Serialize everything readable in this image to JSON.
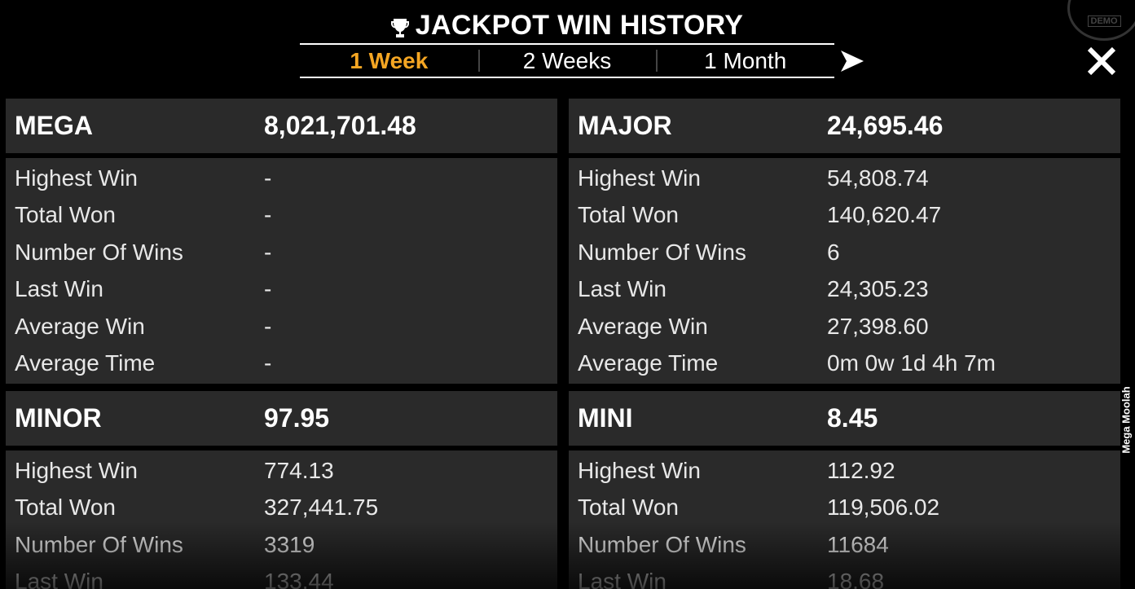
{
  "header": {
    "title": "JACKPOT WIN HISTORY",
    "tabs": [
      {
        "label": "1 Week",
        "active": true
      },
      {
        "label": "2 Weeks",
        "active": false
      },
      {
        "label": "1 Month",
        "active": false
      }
    ],
    "next_icon": "right-arrow-icon",
    "close_icon": "close-icon",
    "badge_text": "DEMO"
  },
  "side_label": "Mega Moolah",
  "colors": {
    "accent": "#f5a623",
    "panel_bg": "#2a2a2a",
    "background": "#000000"
  },
  "panels": [
    {
      "name": "MEGA",
      "amount": "8,021,701.48",
      "rows": [
        {
          "label": "Highest Win",
          "value": "-"
        },
        {
          "label": "Total Won",
          "value": "-"
        },
        {
          "label": "Number Of Wins",
          "value": "-"
        },
        {
          "label": "Last Win",
          "value": "-"
        },
        {
          "label": "Average Win",
          "value": "-"
        },
        {
          "label": "Average Time",
          "value": "-"
        }
      ]
    },
    {
      "name": "MAJOR",
      "amount": "24,695.46",
      "rows": [
        {
          "label": "Highest Win",
          "value": "54,808.74"
        },
        {
          "label": "Total Won",
          "value": "140,620.47"
        },
        {
          "label": "Number Of Wins",
          "value": "6"
        },
        {
          "label": "Last Win",
          "value": "24,305.23"
        },
        {
          "label": "Average Win",
          "value": "27,398.60"
        },
        {
          "label": "Average Time",
          "value": "0m 0w 1d 4h 7m"
        }
      ]
    },
    {
      "name": "MINOR",
      "amount": "97.95",
      "rows": [
        {
          "label": "Highest Win",
          "value": "774.13"
        },
        {
          "label": "Total Won",
          "value": "327,441.75"
        },
        {
          "label": "Number Of Wins",
          "value": "3319"
        },
        {
          "label": "Last Win",
          "value": "133.44"
        }
      ]
    },
    {
      "name": "MINI",
      "amount": "8.45",
      "rows": [
        {
          "label": "Highest Win",
          "value": "112.92"
        },
        {
          "label": "Total Won",
          "value": "119,506.02"
        },
        {
          "label": "Number Of Wins",
          "value": "11684"
        },
        {
          "label": "Last Win",
          "value": "18.68"
        }
      ]
    }
  ]
}
